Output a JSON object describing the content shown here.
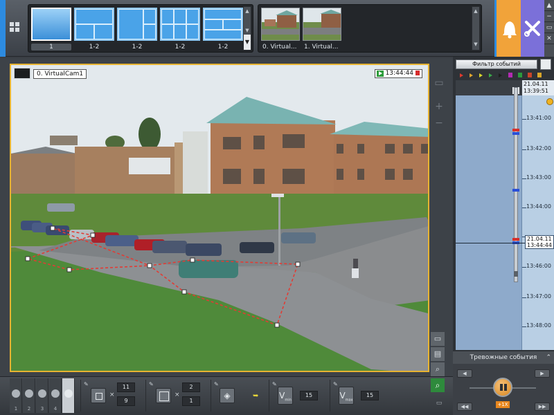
{
  "layouts": [
    {
      "label": "1",
      "active": true
    },
    {
      "label": "1-2",
      "active": false
    },
    {
      "label": "1-2",
      "active": false
    },
    {
      "label": "1-2",
      "active": false
    },
    {
      "label": "1-2",
      "active": false
    }
  ],
  "cameras": [
    {
      "label": "0. Virtual..."
    },
    {
      "label": "1. Virtual..."
    }
  ],
  "video": {
    "camera_title": "0. VirtualCam1",
    "time": "13:44:44"
  },
  "toolbar": {
    "modes": [
      "1",
      "2",
      "3",
      "4"
    ],
    "group1": {
      "a": "11",
      "b": "9"
    },
    "group2": {
      "a": "2",
      "b": "1"
    },
    "group3": {
      "value": "15"
    },
    "group4": {
      "value": "15"
    },
    "times_sign": "×"
  },
  "side": {
    "filter_label": "Фильтр событий",
    "date_top": "21.04.11",
    "time_top": "13:39:51",
    "ticks": [
      "13:41:00",
      "13:42:00",
      "13:43:00",
      "13:44:00",
      "13:45:00",
      "13:46:00",
      "13:47:00",
      "13:48:00"
    ],
    "cursor_date": "21.04.11",
    "cursor_time": "13:44:44",
    "track_top_label": "0",
    "alarm_header": "Тревожные события",
    "speed": "+1X"
  }
}
